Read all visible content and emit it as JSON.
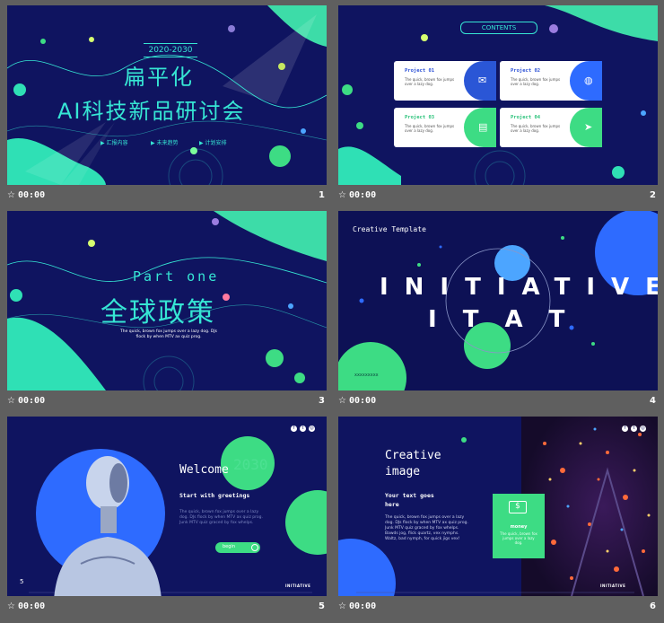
{
  "slides": [
    {
      "number": "1",
      "time": "00:00",
      "year_badge": "2020-2030",
      "title_line1": "扁平化",
      "title_line2": "AI科技新品研讨会",
      "menu": [
        "汇报内容",
        "未来趋势",
        "计划安排"
      ]
    },
    {
      "number": "2",
      "time": "00:00",
      "heading": "CONTENTS",
      "cards": [
        {
          "title": "Project  01",
          "text": "The quick, brown fox jumps over a lazy dog."
        },
        {
          "title": "Project  02",
          "text": "The quick, brown fox jumps over a lazy dog."
        },
        {
          "title": "Project  03",
          "text": "The quick, brown fox jumps over a lazy dog."
        },
        {
          "title": "Project  04",
          "text": "The quick, brown fox jumps over a lazy dog."
        }
      ]
    },
    {
      "number": "3",
      "time": "00:00",
      "part": "Part one",
      "title": "全球政策",
      "body": "The quick, brown fox jumps over a lazy dog. DJs flock by when MTV ax quiz prog."
    },
    {
      "number": "4",
      "time": "00:00",
      "label": "Creative Template",
      "word_top": "INITIATIVE",
      "letters_low": "I T A T",
      "footer_text": "xxxxxxxxx"
    },
    {
      "number": "5",
      "time": "00:00",
      "welcome": "Welcome",
      "ghost": "2030",
      "sub": "Start with greetings",
      "body": "The quick, brown fox jumps over a lazy dog. DJs flock by when MTV ax quiz prog. Junk MTV quiz graced by fox whelps.",
      "button": "begin",
      "side_num": "5",
      "brand": "INITIATIVE"
    },
    {
      "number": "6",
      "time": "00:00",
      "title_line1": "Creative",
      "title_line2": "image",
      "sub_line1": "Your text goes",
      "sub_line2": "here",
      "body": "The quick, brown fox jumps over a lazy dog. DJs flock by when MTV ax quiz prog. Junk MTV quiz graced by fox whelps. Bawds jog, flick quartz, vex nymphs. Waltz, bad nymph, for quick jigs vex!",
      "card_label": "money",
      "card_text": "The quick, brown fox jumps over a lazy dog.",
      "brand": "INITIATIVE"
    }
  ],
  "colors": {
    "bg": "#5f5f5f",
    "navy": "#0f1460",
    "cyan": "#36e6d4",
    "green": "#3ddc84",
    "blue": "#2e6bff"
  }
}
